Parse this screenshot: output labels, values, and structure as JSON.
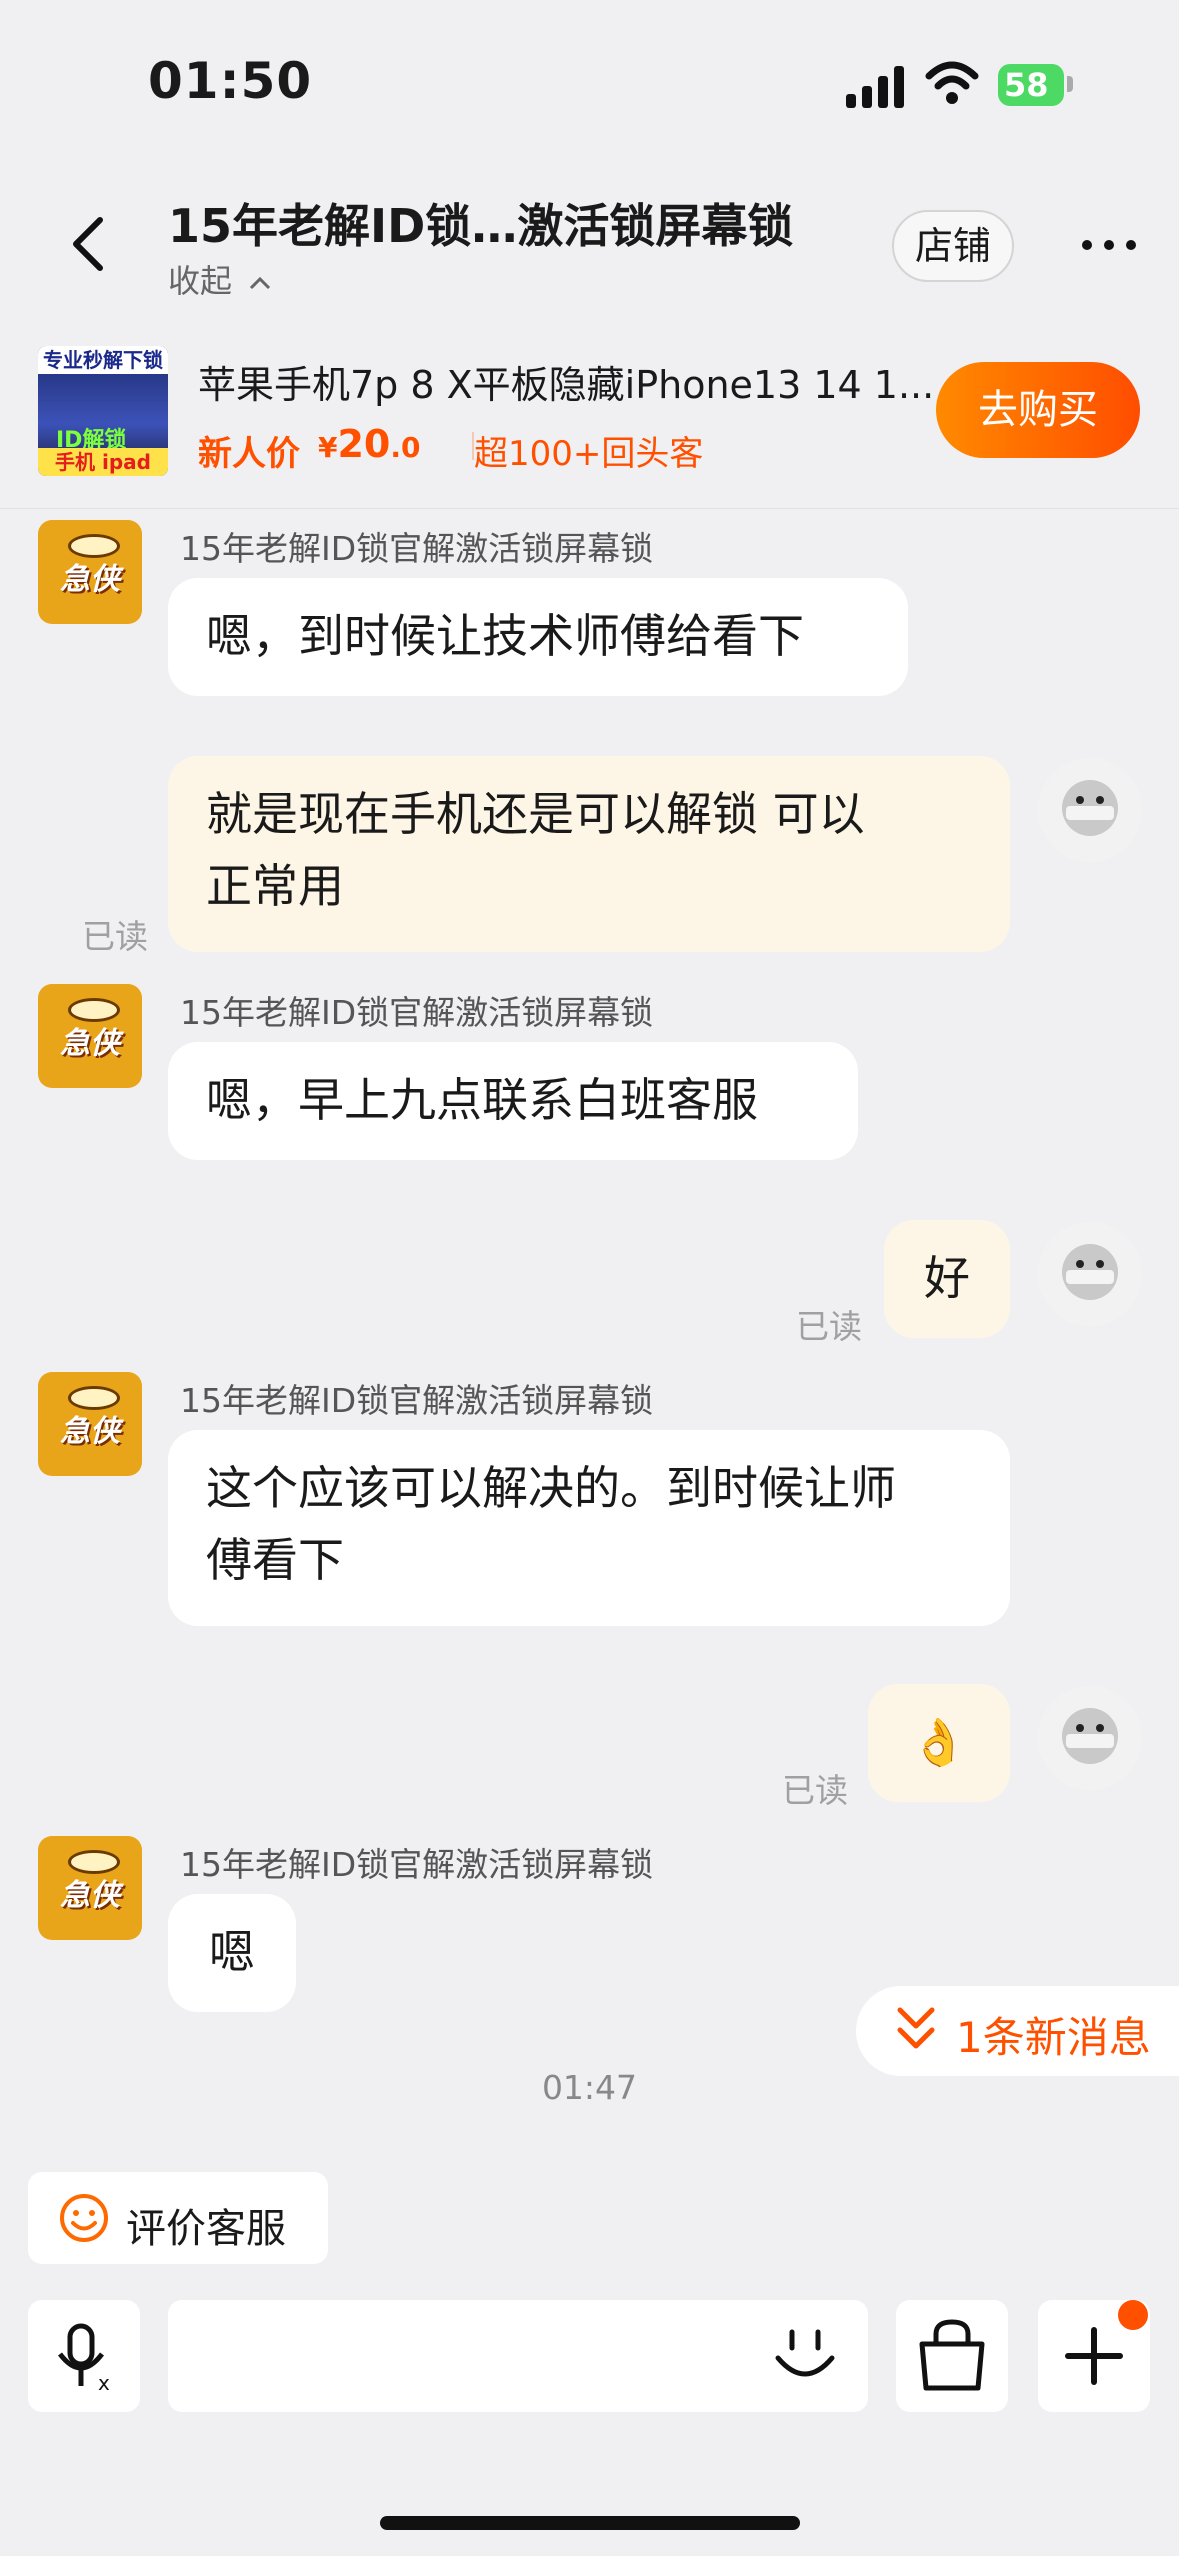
{
  "status_bar": {
    "time": "01:50",
    "battery": "58"
  },
  "header": {
    "title": "15年老解ID锁…激活锁屏幕锁",
    "collapse_label": "收起",
    "store_label": "店铺"
  },
  "product": {
    "thumb_text_top": "专业秒解下锁",
    "thumb_text_mid": "ID解锁",
    "thumb_text_bottom": "手机 ipad",
    "name": "苹果手机7p 8 X平板隐藏iPhone13 14 1...",
    "price_label": "新人价",
    "price_symbol": "¥",
    "price_int": "20",
    "price_dec": ".0",
    "repeat_label": "超100+回头客",
    "buy_label": "去购买"
  },
  "messages": [
    {
      "sender": "15年老解ID锁官解激活锁屏幕锁",
      "text": "嗯，到时候让技术师傅给看下"
    },
    {
      "text_line1": "就是现在手机还是可以解锁 可以",
      "text_line2": "正常用",
      "read": "已读"
    },
    {
      "sender": "15年老解ID锁官解激活锁屏幕锁",
      "text": "嗯，早上九点联系白班客服"
    },
    {
      "text": "好",
      "read": "已读"
    },
    {
      "sender": "15年老解ID锁官解激活锁屏幕锁",
      "text_line1": "这个应该可以解决的。到时候让师",
      "text_line2": "傅看下"
    },
    {
      "text": "👌",
      "read": "已读"
    },
    {
      "sender": "15年老解ID锁官解激活锁屏幕锁",
      "text": "嗯"
    }
  ],
  "shop_logo_text": "急侠",
  "new_messages_label": "1条新消息",
  "timestamp": "01:47",
  "rate_label": "评价客服",
  "colors": {
    "accent": "#ff5000",
    "outgoing_bubble": "#fdf6e6",
    "background": "#f0f0f3"
  }
}
